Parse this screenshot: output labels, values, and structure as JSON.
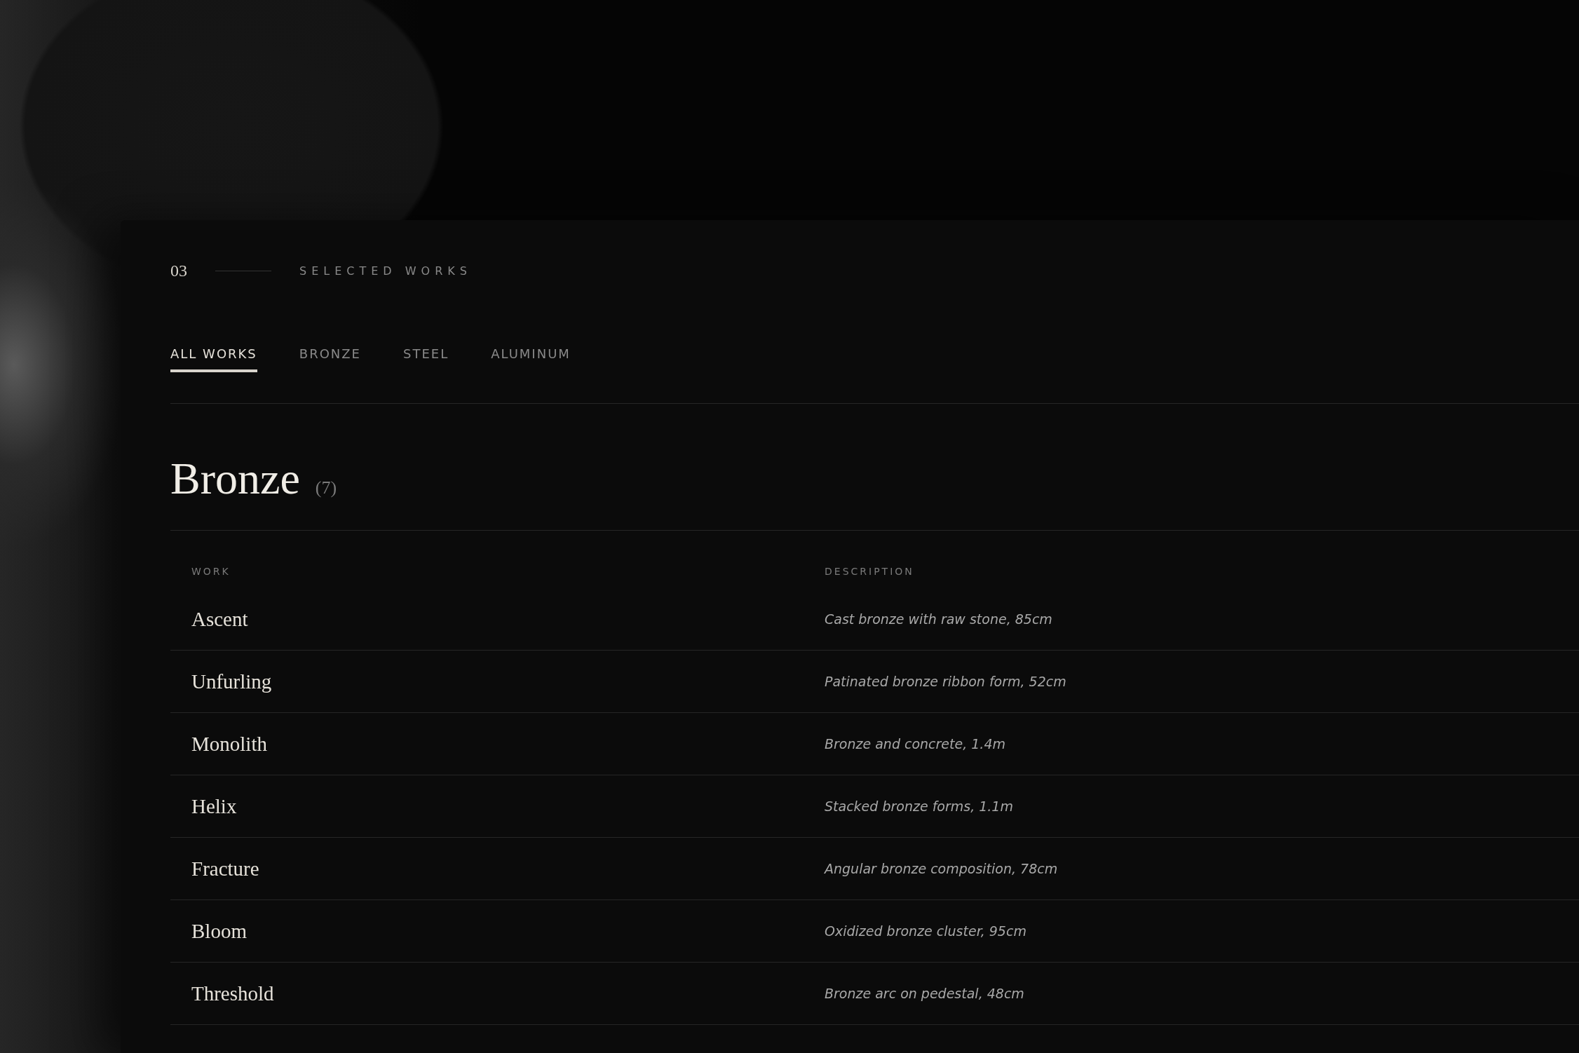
{
  "section": {
    "number": "03",
    "label": "SELECTED WORKS"
  },
  "tabs": [
    {
      "label": "ALL WORKS",
      "selected": true
    },
    {
      "label": "BRONZE",
      "selected": false
    },
    {
      "label": "STEEL",
      "selected": false
    },
    {
      "label": "ALUMINUM",
      "selected": false
    }
  ],
  "group": {
    "title": "Bronze",
    "count": "(7)"
  },
  "table": {
    "columns": [
      "WORK",
      "DESCRIPTION"
    ],
    "rows": [
      {
        "work": "Ascent",
        "description": "Cast bronze with raw stone, 85cm"
      },
      {
        "work": "Unfurling",
        "description": "Patinated bronze ribbon form, 52cm"
      },
      {
        "work": "Monolith",
        "description": "Bronze and concrete, 1.4m"
      },
      {
        "work": "Helix",
        "description": "Stacked bronze forms, 1.1m"
      },
      {
        "work": "Fracture",
        "description": "Angular bronze composition, 78cm"
      },
      {
        "work": "Bloom",
        "description": "Oxidized bronze cluster, 95cm"
      },
      {
        "work": "Threshold",
        "description": "Bronze arc on pedestal, 48cm"
      }
    ]
  }
}
